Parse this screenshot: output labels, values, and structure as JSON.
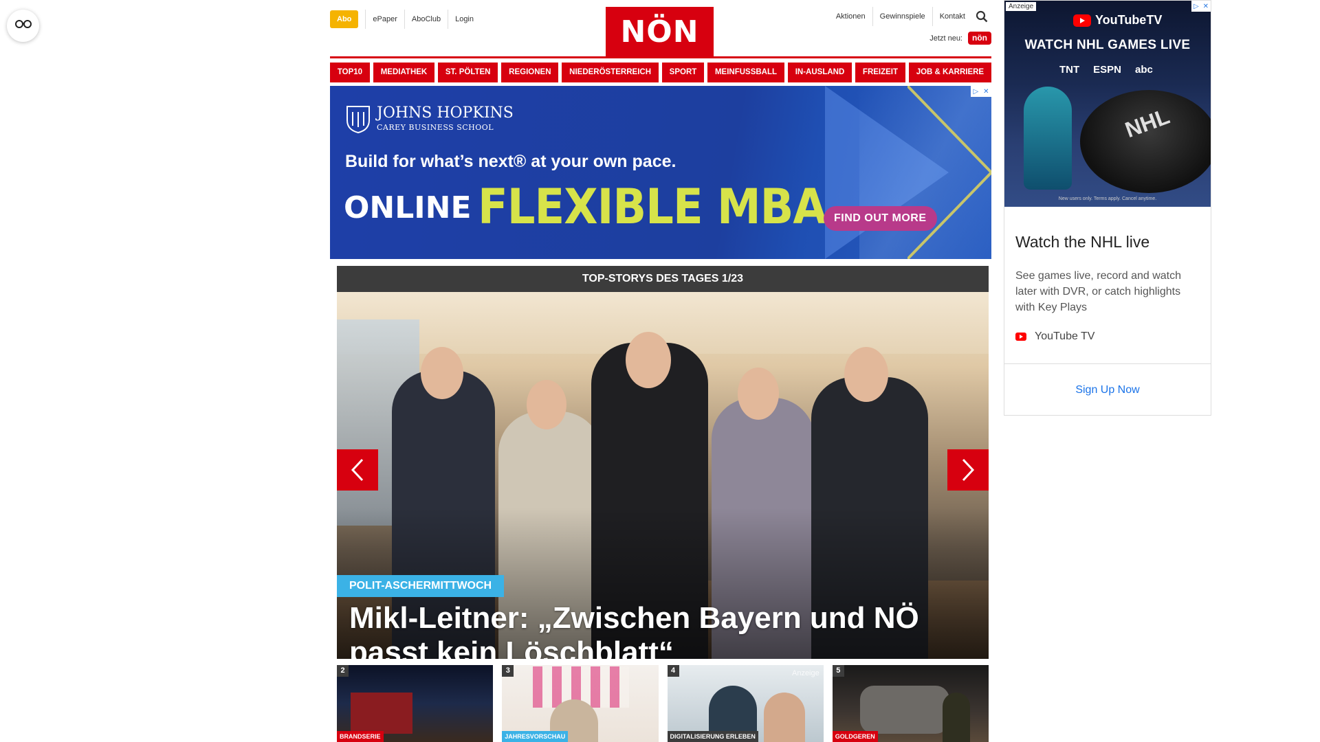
{
  "reader": {
    "icon": "glasses-icon"
  },
  "topnav": {
    "abo": "Abo",
    "left_links": [
      "ePaper",
      "AboClub",
      "Login"
    ],
    "right_links": [
      "Aktionen",
      "Gewinnspiele",
      "Kontakt"
    ],
    "jetzt_label": "Jetzt neu:",
    "jetzt_badge": "nön"
  },
  "logo": {
    "text": "NÖN",
    "color": "#d7000f"
  },
  "mainnav": [
    "TOP10",
    "MEDIATHEK",
    "ST. PÖLTEN",
    "REGIONEN",
    "NIEDERÖSTERREICH",
    "SPORT",
    "MEINFUSSBALL",
    "IN-AUSLAND",
    "FREIZEIT",
    "JOB & KARRIERE"
  ],
  "ad_banner": {
    "brand": "JOHNS HOPKINS",
    "brand_sub": "CAREY BUSINESS SCHOOL",
    "headline": "Build for what’s next® at your own pace.",
    "online": "ONLINE",
    "flexible": "FLEXIBLE MBA",
    "cta": "FIND OUT MORE"
  },
  "top_story": {
    "header": "TOP-STORYS DES TAGES 1/23",
    "kicker": "POLIT-ASCHERMITTWOCH",
    "title": "Mikl-Leitner: „Zwischen Bayern und NÖ passt kein Löschblatt“"
  },
  "thumbs": [
    {
      "num": "2",
      "tag": "BRANDSERIE",
      "tag_color": "#d7000f"
    },
    {
      "num": "3",
      "tag": "JAHRESVORSCHAU",
      "tag_color": "#3bb2e6"
    },
    {
      "num": "4",
      "tag": "DIGITALISIERUNG ERLEBEN",
      "tag_color": "#3c3c3c",
      "anzeige": "Anzeige"
    },
    {
      "num": "5",
      "tag": "GOLDGEREN",
      "tag_color": "#d7000f"
    }
  ],
  "sidebar_ad": {
    "anzeige": "Anzeige",
    "yt_brand": "YouTubeTV",
    "yt_headline": "WATCH NHL GAMES LIVE",
    "networks": [
      "TNT",
      "ESPN",
      "abc"
    ],
    "fine_print": "New users only. Terms apply. Cancel anytime.",
    "title": "Watch the NHL live",
    "description": "See games live, record and watch later with DVR, or catch highlights with Key Plays",
    "brand": "YouTube TV",
    "cta": "Sign Up Now"
  }
}
